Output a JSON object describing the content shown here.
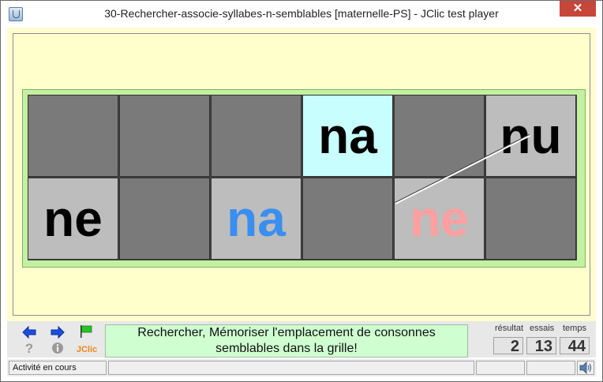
{
  "window": {
    "title": "30-Rechercher-associe-syllabes-n-semblables [maternelle-PS] - JClic test player",
    "close_label": "✕"
  },
  "grid": {
    "cells": [
      {
        "text": "",
        "state": "hidden",
        "color": "#000000"
      },
      {
        "text": "",
        "state": "hidden",
        "color": "#000000"
      },
      {
        "text": "",
        "state": "hidden",
        "color": "#000000"
      },
      {
        "text": "na",
        "state": "selected",
        "color": "#000000"
      },
      {
        "text": "",
        "state": "hidden",
        "color": "#000000"
      },
      {
        "text": "nu",
        "state": "shown",
        "color": "#000000"
      },
      {
        "text": "ne",
        "state": "shown",
        "color": "#000000"
      },
      {
        "text": "",
        "state": "hidden",
        "color": "#000000"
      },
      {
        "text": "na",
        "state": "shown",
        "color": "#3a8ef0"
      },
      {
        "text": "",
        "state": "hidden",
        "color": "#000000"
      },
      {
        "text": "ne",
        "state": "shown",
        "color": "#ff9f9f"
      },
      {
        "text": "",
        "state": "hidden",
        "color": "#000000"
      }
    ]
  },
  "toolbar": {
    "prev_icon": "arrow-left-icon",
    "next_icon": "arrow-right-icon",
    "restart_icon": "green-flag-icon",
    "help_icon": "question-icon",
    "info_icon": "info-icon",
    "jclic_label": "JClic"
  },
  "message": "Rechercher, Mémoriser l'emplacement de consonnes semblables dans la grille!",
  "counters": {
    "score_label": "résultat",
    "score_value": "2",
    "tries_label": "essais",
    "tries_value": "13",
    "time_label": "temps",
    "time_value": "44"
  },
  "status": {
    "text": "Activité en cours",
    "sound_icon": "speaker-icon"
  }
}
